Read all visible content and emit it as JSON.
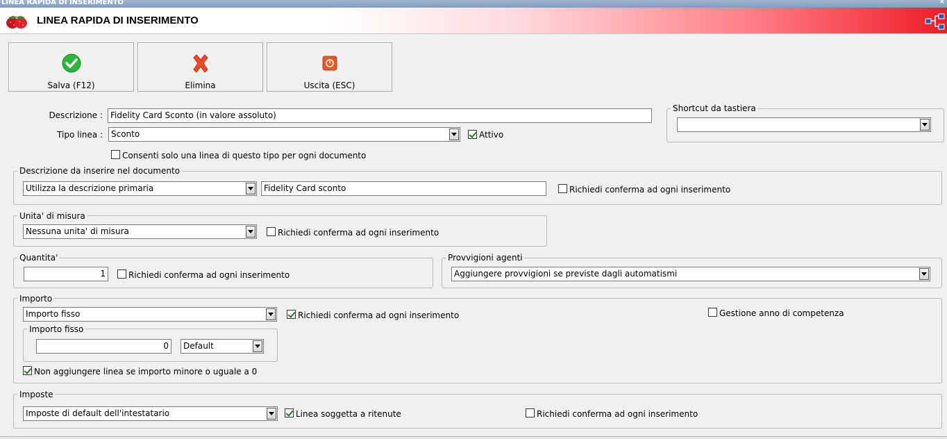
{
  "window": {
    "title": "LINEA RAPIDA DI INSERIMENTO",
    "close": "×"
  },
  "header": {
    "title": "LINEA RAPIDA DI INSERIMENTO"
  },
  "toolbar": {
    "save_label": "Salva (F12)",
    "delete_label": "Elimina",
    "exit_label": "Uscita (ESC)"
  },
  "form": {
    "descrizione_label": "Descrizione :",
    "descrizione_value": "Fidelity Card Sconto (in valore assoluto)",
    "tipo_linea_label": "Tipo linea :",
    "tipo_linea_value": "Sconto",
    "attivo_label": "Attivo",
    "attivo_checked": true,
    "consenti_label": "Consenti solo una linea di questo tipo per ogni documento",
    "consenti_checked": false
  },
  "shortcut": {
    "legend": "Shortcut da tastiera",
    "value": ""
  },
  "descrizione_doc": {
    "legend": "Descrizione da inserire nel documento",
    "mode_value": "Utilizza la descrizione primaria",
    "text_value": "Fidelity Card sconto",
    "confirm_label": "Richiedi conferma ad ogni inserimento",
    "confirm_checked": false
  },
  "unita": {
    "legend": "Unita' di misura",
    "value": "Nessuna unita' di misura",
    "confirm_label": "Richiedi conferma ad ogni inserimento",
    "confirm_checked": false
  },
  "quantita": {
    "legend": "Quantita'",
    "value": "1",
    "confirm_label": "Richiedi conferma ad ogni inserimento",
    "confirm_checked": false
  },
  "provvigioni": {
    "legend": "Provvigioni agenti",
    "value": "Aggiungere provvigioni se previste dagli automatismi"
  },
  "importo": {
    "legend": "Importo",
    "mode_value": "Importo fisso",
    "confirm_label": "Richiedi conferma ad ogni inserimento",
    "confirm_checked": true,
    "gestione_label": "Gestione anno di competenza",
    "gestione_checked": false,
    "fisso_legend": "Importo fisso",
    "fisso_value": "0",
    "fisso_option": "Default",
    "non_aggiungere_label": "Non aggiungere linea se importo minore o uguale a 0",
    "non_aggiungere_checked": true
  },
  "imposte": {
    "legend": "Imposte",
    "value": "Imposte di default dell'intestatario",
    "ritenute_label": "Linea soggetta a ritenute",
    "ritenute_checked": true,
    "confirm_label": "Richiedi conferma ad ogni inserimento",
    "confirm_checked": false
  },
  "colors": {
    "accent_red": "#ee1c26",
    "check_green": "#1a7f1a"
  }
}
